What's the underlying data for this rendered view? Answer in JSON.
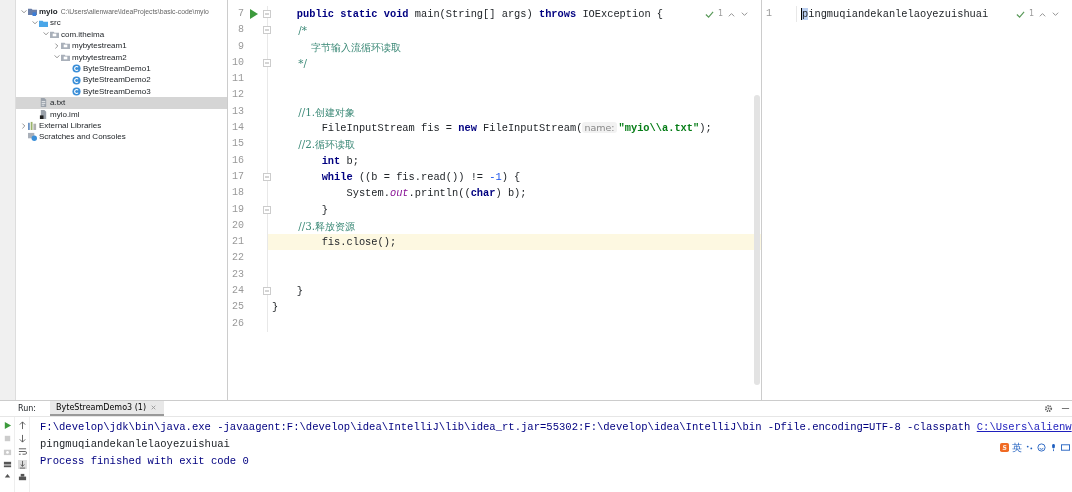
{
  "project_tree": {
    "items": [
      {
        "label": "myio",
        "path": "C:\\Users\\alienware\\IdeaProjects\\basic-code\\myio",
        "kind": "module",
        "expanded": true,
        "selected": false,
        "children": [
          {
            "label": "src",
            "kind": "source",
            "expanded": true,
            "selected": false,
            "children": [
              {
                "label": "com.itheima",
                "kind": "package",
                "expanded": true,
                "selected": false,
                "children": [
                  {
                    "label": "mybytestream1",
                    "kind": "package",
                    "expanded": false,
                    "selected": false
                  },
                  {
                    "label": "mybytestream2",
                    "kind": "package",
                    "expanded": true,
                    "selected": false,
                    "children": [
                      {
                        "label": "ByteStreamDemo1",
                        "kind": "class",
                        "selected": false
                      },
                      {
                        "label": "ByteStreamDemo2",
                        "kind": "class",
                        "selected": false
                      },
                      {
                        "label": "ByteStreamDemo3",
                        "kind": "class",
                        "selected": false
                      }
                    ]
                  }
                ]
              }
            ]
          },
          {
            "label": "a.txt",
            "kind": "text",
            "selected": true
          },
          {
            "label": "myio.iml",
            "kind": "iml",
            "selected": false
          }
        ]
      },
      {
        "label": "External Libraries",
        "kind": "library",
        "expanded": false,
        "selected": false
      },
      {
        "label": "Scratches and Consoles",
        "kind": "scratch",
        "selected": false
      }
    ]
  },
  "editor": {
    "inspection_count": "1",
    "lines": [
      {
        "number": "7",
        "current": false,
        "run": true,
        "fold": true,
        "tokens": [
          {
            "text": "    public static void",
            "kind": "keyword"
          },
          {
            "text": " main(String[] args) ",
            "kind": "plain"
          },
          {
            "text": "throws",
            "kind": "keyword"
          },
          {
            "text": " IOException {",
            "kind": "plain"
          }
        ]
      },
      {
        "number": "8",
        "current": false,
        "run": false,
        "fold": true,
        "tokens": [
          {
            "text": "        /*",
            "kind": "comment"
          }
        ]
      },
      {
        "number": "9",
        "current": false,
        "run": false,
        "fold": false,
        "tokens": [
          {
            "text": "            字节输入流循环读取",
            "kind": "comment"
          }
        ]
      },
      {
        "number": "10",
        "current": false,
        "run": false,
        "fold": true,
        "tokens": [
          {
            "text": "        */",
            "kind": "comment"
          }
        ]
      },
      {
        "number": "11",
        "current": false,
        "run": false,
        "fold": false
      },
      {
        "number": "12",
        "current": false,
        "run": false,
        "fold": false
      },
      {
        "number": "13",
        "current": false,
        "run": false,
        "fold": false,
        "tokens": [
          {
            "text": "        //1.创建对象",
            "kind": "comment"
          }
        ]
      },
      {
        "number": "14",
        "current": false,
        "run": false,
        "fold": false,
        "tokens": [
          {
            "text": "        FileInputStream fis = ",
            "kind": "plain"
          },
          {
            "text": "new",
            "kind": "keyword"
          },
          {
            "text": " FileInputStream(",
            "kind": "plain"
          },
          {
            "text": "name:",
            "kind": "hint"
          },
          {
            "text": "\"myio\\\\a.txt\"",
            "kind": "string"
          },
          {
            "text": ");",
            "kind": "plain"
          }
        ]
      },
      {
        "number": "15",
        "current": false,
        "run": false,
        "fold": false,
        "tokens": [
          {
            "text": "        //2.循环读取",
            "kind": "comment"
          }
        ]
      },
      {
        "number": "16",
        "current": false,
        "run": false,
        "fold": false,
        "tokens": [
          {
            "text": "        int",
            "kind": "keyword"
          },
          {
            "text": " b;",
            "kind": "plain"
          }
        ]
      },
      {
        "number": "17",
        "current": false,
        "run": false,
        "fold": true,
        "tokens": [
          {
            "text": "        while",
            "kind": "keyword"
          },
          {
            "text": " ((b = fis.read()) != ",
            "kind": "plain"
          },
          {
            "text": "-1",
            "kind": "number"
          },
          {
            "text": ") {",
            "kind": "plain"
          }
        ]
      },
      {
        "number": "18",
        "current": false,
        "run": false,
        "fold": false,
        "tokens": [
          {
            "text": "            System.",
            "kind": "plain"
          },
          {
            "text": "out",
            "kind": "field"
          },
          {
            "text": ".println((",
            "kind": "plain"
          },
          {
            "text": "char",
            "kind": "keyword"
          },
          {
            "text": ") b);",
            "kind": "plain"
          }
        ]
      },
      {
        "number": "19",
        "current": false,
        "run": false,
        "fold": true,
        "tokens": [
          {
            "text": "        }",
            "kind": "plain"
          }
        ]
      },
      {
        "number": "20",
        "current": false,
        "run": false,
        "fold": false,
        "tokens": [
          {
            "text": "        //3.释放资源",
            "kind": "comment"
          }
        ]
      },
      {
        "number": "21",
        "current": true,
        "run": false,
        "fold": false,
        "tokens": [
          {
            "text": "        fis.close();",
            "kind": "plain"
          }
        ]
      },
      {
        "number": "22",
        "current": false,
        "run": false,
        "fold": false
      },
      {
        "number": "23",
        "current": false,
        "run": false,
        "fold": false
      },
      {
        "number": "24",
        "current": false,
        "run": false,
        "fold": true,
        "tokens": [
          {
            "text": "    }",
            "kind": "plain"
          }
        ]
      },
      {
        "number": "25",
        "current": false,
        "run": false,
        "fold": false,
        "tokens": [
          {
            "text": "}",
            "kind": "plain"
          }
        ]
      },
      {
        "number": "26",
        "current": false,
        "run": false,
        "fold": false
      }
    ]
  },
  "text_editor": {
    "inspection_count": "1",
    "lines": [
      {
        "number": "1",
        "text": "pingmuqiandekanlelaoyezuishuai"
      }
    ]
  },
  "run_panel": {
    "label": "Run:",
    "tabs": [
      {
        "label": "ByteStreamDemo3 (1)",
        "selected": true
      }
    ],
    "console": [
      {
        "kind": "command",
        "tokens": [
          {
            "text": "F:\\develop\\jdk\\bin\\java.exe -javaagent:F:\\develop\\idea\\IntelliJ\\lib\\idea_rt.jar=55302:F:\\develop\\idea\\IntelliJ\\bin -Dfile.encoding=UTF-8 -classpath ",
            "kind": "plain"
          },
          {
            "text": "C:\\Users\\alienw",
            "kind": "link"
          }
        ]
      },
      {
        "kind": "output",
        "tokens": [
          {
            "text": "pingmuqiandekanlelaoyezuishuai",
            "kind": "plain"
          }
        ]
      },
      {
        "kind": "status",
        "tokens": [
          {
            "text": "Process finished with exit code 0",
            "kind": "plain"
          }
        ]
      }
    ]
  },
  "ime_bar": {
    "mode": "英"
  }
}
